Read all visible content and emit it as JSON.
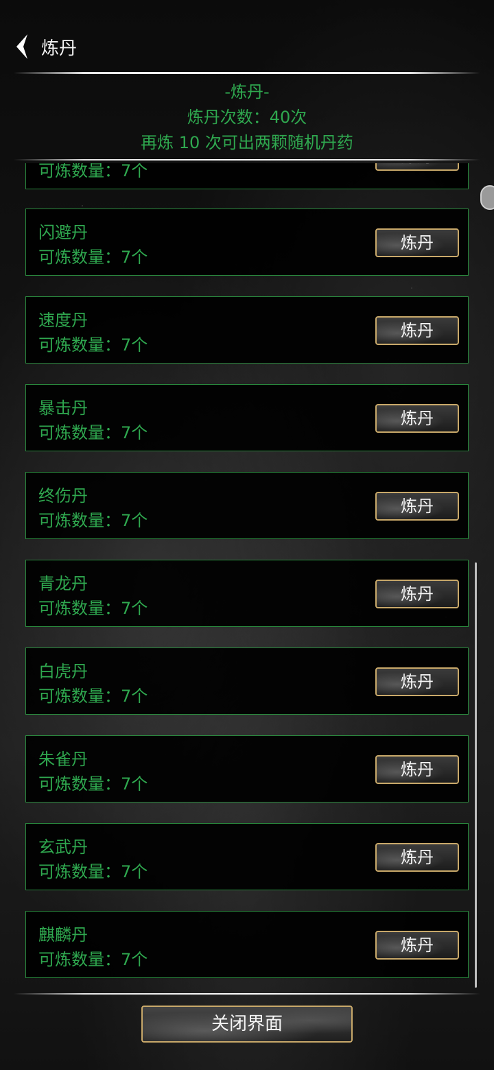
{
  "topbar": {
    "title": "炼丹"
  },
  "header": {
    "heading": "-炼丹-",
    "count_line": "炼丹次数：40次",
    "hint_line": "再炼 10 次可出两颗随机丹药"
  },
  "common": {
    "count_label": "可炼数量：",
    "refine_label": "炼丹"
  },
  "items": [
    {
      "name": "",
      "count": "7个"
    },
    {
      "name": "闪避丹",
      "count": "7个"
    },
    {
      "name": "速度丹",
      "count": "7个"
    },
    {
      "name": "暴击丹",
      "count": "7个"
    },
    {
      "name": "终伤丹",
      "count": "7个"
    },
    {
      "name": "青龙丹",
      "count": "7个"
    },
    {
      "name": "白虎丹",
      "count": "7个"
    },
    {
      "name": "朱雀丹",
      "count": "7个"
    },
    {
      "name": "玄武丹",
      "count": "7个"
    },
    {
      "name": "麒麟丹",
      "count": "7个"
    }
  ],
  "footer": {
    "close_label": "关闭界面"
  }
}
